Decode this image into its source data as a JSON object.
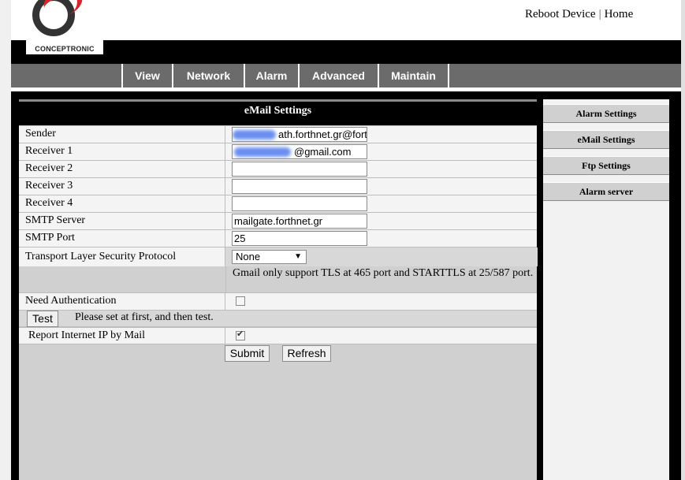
{
  "header": {
    "brand": "CONCEPTRONIC",
    "links": {
      "reboot": "Reboot Device",
      "separator": "|",
      "home": "Home"
    }
  },
  "nav": {
    "items": [
      "View",
      "Network",
      "Alarm",
      "Advanced",
      "Maintain"
    ]
  },
  "email_settings": {
    "title": "eMail Settings",
    "fields": {
      "sender": {
        "label": "Sender",
        "value": "ath.forthnet.gr@fort"
      },
      "receiver1": {
        "label": "Receiver 1",
        "value": "@gmail.com"
      },
      "receiver2": {
        "label": "Receiver 2",
        "value": ""
      },
      "receiver3": {
        "label": "Receiver 3",
        "value": ""
      },
      "receiver4": {
        "label": "Receiver 4",
        "value": ""
      },
      "smtp_server": {
        "label": "SMTP Server",
        "value": "mailgate.forthnet.gr"
      },
      "smtp_port": {
        "label": "SMTP Port",
        "value": "25"
      }
    },
    "tls": {
      "label": "Transport Layer Security Protocol",
      "value": "None"
    },
    "note": "Gmail only support TLS at 465 port and STARTTLS at 25/587 port.",
    "need_auth": {
      "label": "Need Authentication",
      "checked": false
    },
    "test": {
      "button": "Test",
      "hint": "Please set at first, and then test."
    },
    "report_ip": {
      "label": "Report Internet IP by Mail",
      "checked": true
    },
    "buttons": {
      "submit": "Submit",
      "refresh": "Refresh"
    }
  },
  "side_menu": {
    "items": [
      "Alarm Settings",
      "eMail Settings",
      "Ftp Settings",
      "Alarm server"
    ]
  },
  "colors": {
    "nav_bg": "#6b6b6b",
    "panel_bg": "#d0d0d0",
    "accent_red": "#d8252a"
  },
  "icons": {
    "select_arrow": "chevron-down-icon",
    "checkbox": "check-icon"
  }
}
